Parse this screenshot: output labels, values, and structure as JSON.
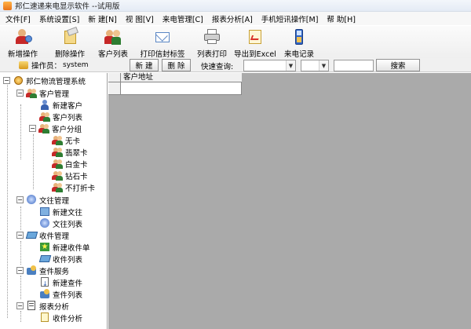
{
  "window": {
    "title": "邦仁速递来电显示软件 --试用版"
  },
  "menu": [
    "文件[F]",
    "系统设置[S]",
    "新 建[N]",
    "视 图[V]",
    "来电管理[C]",
    "报表分析[A]",
    "手机短讯操作[M]",
    "帮 助[H]"
  ],
  "toolbar": [
    "新增操作",
    "删除操作",
    "客户列表",
    "打印信封标签",
    "列表打印",
    "导出到Excel",
    "来电记录"
  ],
  "operator": {
    "label": "操作员：",
    "user": "system"
  },
  "actions": {
    "new": "新 建",
    "delete": "删 除",
    "query_label": "快速查询:",
    "search": "搜索"
  },
  "tree": {
    "root": "邦仁物流管理系统",
    "customer": "客户管理",
    "new_customer": "新建客户",
    "customer_list": "客户列表",
    "customer_group": "客户分组",
    "groups": [
      "无卡",
      "翡翠卡",
      "白金卡",
      "钻石卡",
      "不打折卡"
    ],
    "doc": "文往管理",
    "new_doc": "新建文往",
    "doc_list": "文往列表",
    "receive": "收件管理",
    "new_receive": "新建收件单",
    "receive_list": "收件列表",
    "check": "查件服务",
    "new_check": "新建查件",
    "check_list": "查件列表",
    "report": "报表分析",
    "report_sub": "收件分析"
  },
  "grid": {
    "column": "客户地址"
  }
}
